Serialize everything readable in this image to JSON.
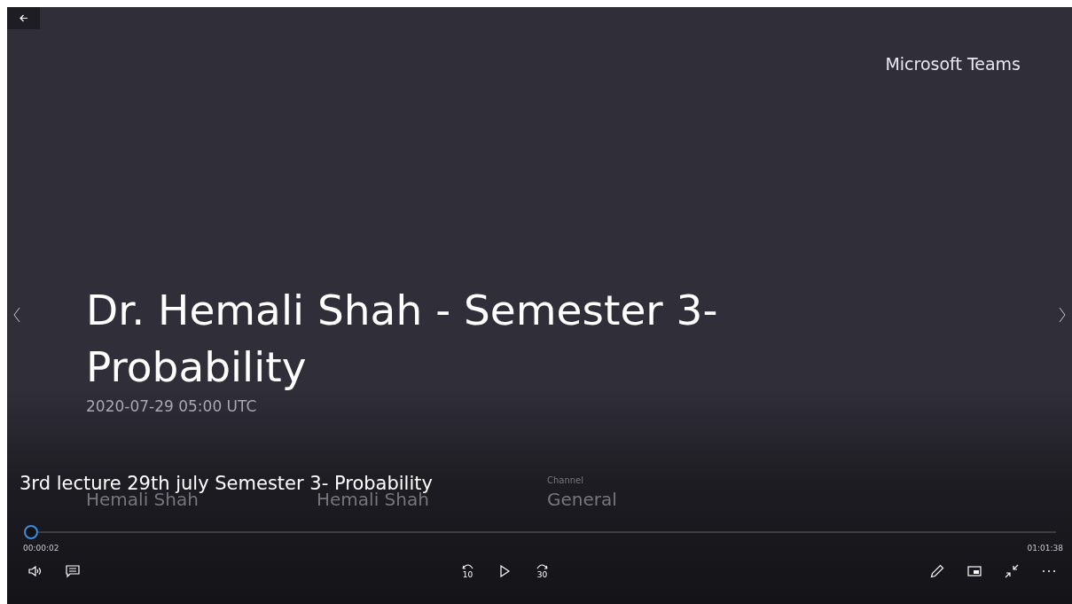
{
  "brand": "Microsoft Teams",
  "title": "Dr. Hemali Shah - Semester 3- Probability",
  "date": "2020-07-29 05:00 UTC",
  "details": [
    {
      "value": "Hemali Shah"
    },
    {
      "value": "Hemali Shah"
    },
    {
      "label": "Channel",
      "value": "General"
    }
  ],
  "caption": "3rd lecture 29th july Semester 3- Probability",
  "progress": {
    "level": 0.001,
    "elapsed": "00:00:02",
    "duration": "01:01:38"
  },
  "left_controls": [
    {
      "kind": "volume"
    },
    {
      "kind": "captions"
    }
  ],
  "center_controls": [
    {
      "kind": "back",
      "text": "10"
    },
    {
      "kind": "play"
    },
    {
      "kind": "forward",
      "text": "30"
    }
  ],
  "right_controls": [
    {
      "kind": "pen"
    },
    {
      "kind": "pip"
    },
    {
      "kind": "shrink"
    },
    {
      "kind": "more"
    }
  ]
}
